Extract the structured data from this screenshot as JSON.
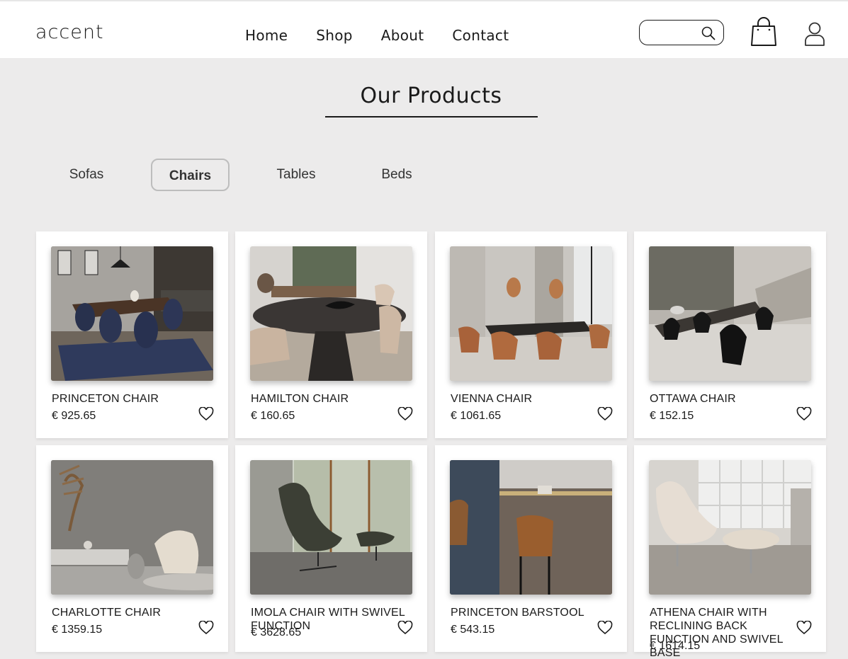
{
  "header": {
    "logo": "accent",
    "nav": [
      "Home",
      "Shop",
      "About",
      "Contact"
    ],
    "search": {
      "value": "",
      "placeholder": "",
      "icon": "search-icon"
    },
    "icons": [
      "shopping-bag-icon",
      "user-icon"
    ]
  },
  "section": {
    "title": "Our Products"
  },
  "tabs": [
    {
      "label": "Sofas",
      "active": false
    },
    {
      "label": "Chairs",
      "active": true
    },
    {
      "label": "Tables",
      "active": false
    },
    {
      "label": "Beds",
      "active": false
    }
  ],
  "products": [
    {
      "name": "PRINCETON CHAIR",
      "price": "€ 925.65"
    },
    {
      "name": "HAMILTON CHAIR",
      "price": "€ 160.65"
    },
    {
      "name": "VIENNA CHAIR",
      "price": "€ 1061.65"
    },
    {
      "name": "OTTAWA CHAIR",
      "price": "€ 152.15"
    },
    {
      "name": "CHARLOTTE CHAIR",
      "price": "€ 1359.15"
    },
    {
      "name": "IMOLA CHAIR WITH SWIVEL FUNCTION",
      "price": "€ 3628.65"
    },
    {
      "name": "PRINCETON BARSTOOL",
      "price": "€ 543.15"
    },
    {
      "name": "ATHENA CHAIR WITH RECLINING BACK FUNCTION AND SWIVEL BASE",
      "price": "€ 1614.15"
    }
  ],
  "colors": {
    "page_bg": "#ecebeb",
    "card_bg": "#ffffff",
    "text": "#1a1a1a",
    "active_tab_border": "#bdbdbd"
  }
}
